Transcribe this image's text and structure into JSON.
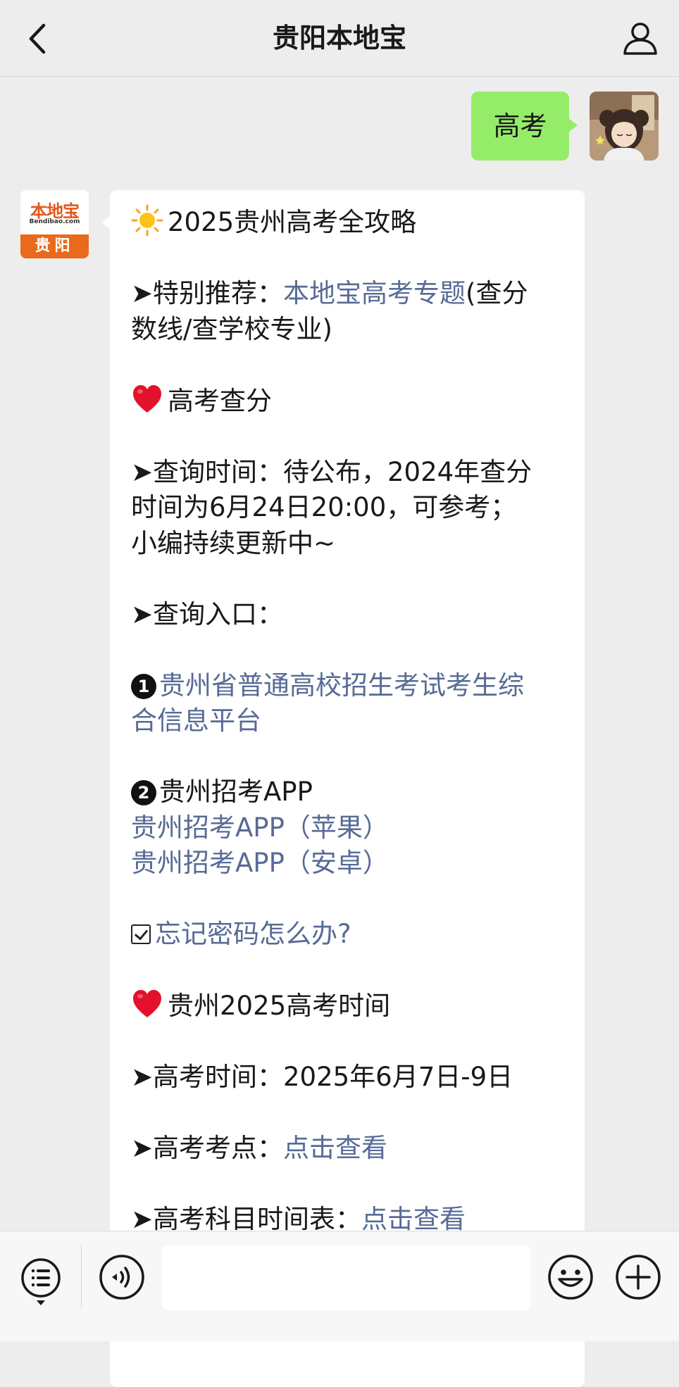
{
  "header": {
    "title": "贵阳本地宝"
  },
  "sent_message": {
    "text": "高考"
  },
  "sender_avatar": {
    "logo_text": "本地宝",
    "logo_sub": "Bendibao.com",
    "city": "贵阳"
  },
  "article": {
    "title": "2025贵州高考全攻略",
    "recommend_prefix": "➤特别推荐：",
    "recommend_link": "本地宝高考专题",
    "recommend_suffix_1": "(查分",
    "recommend_suffix_2": "数线/查学校专业)",
    "section1_title": "高考查分",
    "query_time_1": "➤查询时间：待公布，2024年查分",
    "query_time_2": "时间为6月24日20:00，可参考；",
    "query_time_3": "小编持续更新中~",
    "query_entry": "➤查询入口：",
    "entry1_link_1": "贵州省普通高校招生考试考生综",
    "entry1_link_2": "合信息平台",
    "entry1_badge": "1",
    "entry2_badge": "2",
    "entry2_title": "贵州招考APP",
    "entry2_ios": "贵州招考APP（苹果）",
    "entry2_android": "贵州招考APP（安卓）",
    "forgot_password": "忘记密码怎么办?",
    "section2_title": "贵州2025高考时间",
    "exam_time": "➤高考时间：2025年6月7日-9日",
    "exam_site_prefix": "➤高考考点：",
    "exam_site_link": "点击查看",
    "schedule_prefix": "➤高考科目时间表：",
    "schedule_link": "点击查看"
  },
  "colors": {
    "link": "#576b95",
    "sent_bubble": "#95ec69",
    "background": "#ededed"
  },
  "icons": [
    "back-arrow-icon",
    "profile-icon",
    "sun-emoji-icon",
    "heart-emoji-icon",
    "checkbox-icon",
    "menu-list-icon",
    "voice-icon",
    "emoji-icon",
    "plus-icon"
  ]
}
